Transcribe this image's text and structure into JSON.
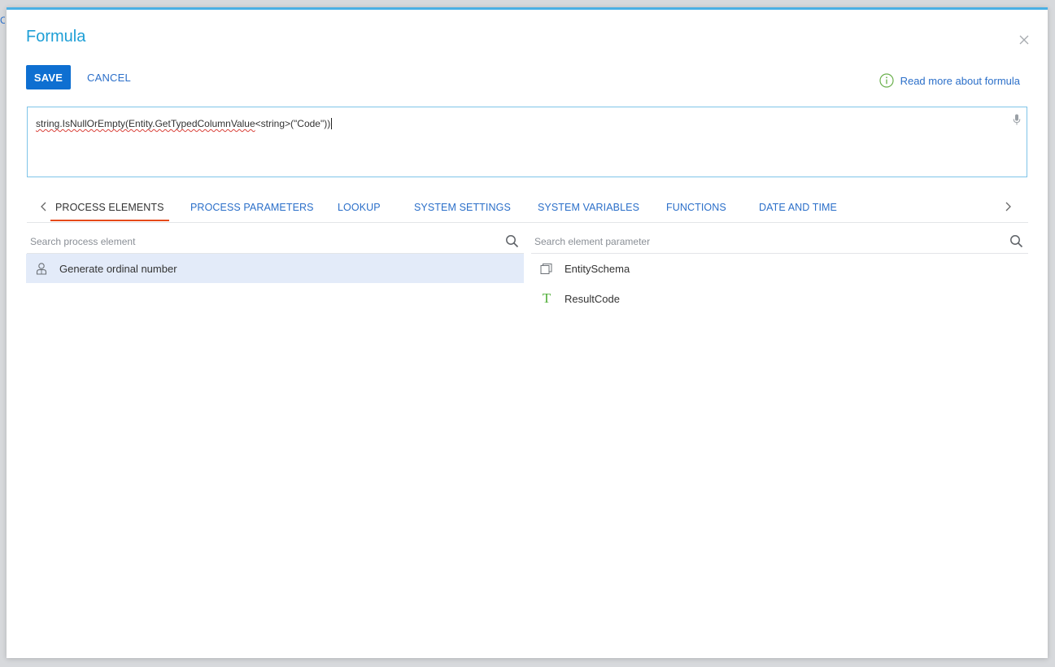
{
  "edge_text": "CE",
  "dialog": {
    "title": "Formula",
    "save_label": "SAVE",
    "cancel_label": "CANCEL",
    "read_more_label": "Read more about formula",
    "formula": {
      "part1": "string.IsNullOrEmpty(Entity.GetTypedColumnValue",
      "part2": "<string>(\"Code\"))"
    }
  },
  "tabs": [
    {
      "label": "PROCESS ELEMENTS",
      "active": true
    },
    {
      "label": "PROCESS PARAMETERS"
    },
    {
      "label": "LOOKUP"
    },
    {
      "label": "SYSTEM SETTINGS"
    },
    {
      "label": "SYSTEM VARIABLES"
    },
    {
      "label": "FUNCTIONS"
    },
    {
      "label": "DATE AND TIME"
    }
  ],
  "left_panel": {
    "search_placeholder": "Search process element",
    "items": [
      {
        "label": "Generate ordinal number",
        "icon": "user-task-icon",
        "selected": true
      }
    ]
  },
  "right_panel": {
    "search_placeholder": "Search element parameter",
    "items": [
      {
        "label": "EntitySchema",
        "icon": "object-stack-icon"
      },
      {
        "label": "ResultCode",
        "icon": "text-type-icon"
      }
    ]
  },
  "colors": {
    "title": "#1e9fd6",
    "accent": "#0e6fd1",
    "link": "#2b6fc9",
    "active_tab_underline": "#e64a19",
    "selected_row": "#e3ebf9",
    "text_type_icon": "#4fae37",
    "info_icon": "#6ab04c"
  }
}
